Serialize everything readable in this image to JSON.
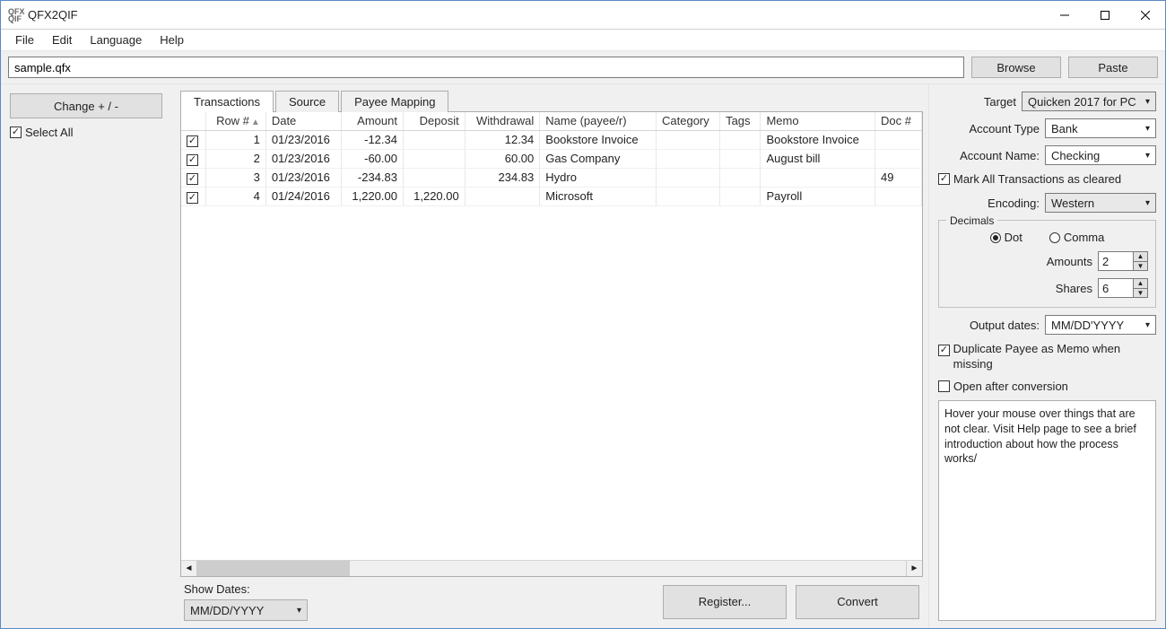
{
  "window": {
    "title": "QFX2QIF"
  },
  "menu": {
    "file": "File",
    "edit": "Edit",
    "language": "Language",
    "help": "Help"
  },
  "toolbar": {
    "file_value": "sample.qfx",
    "browse": "Browse",
    "paste": "Paste"
  },
  "left": {
    "change_btn": "Change + / -",
    "select_all": "Select All"
  },
  "tabs": {
    "transactions": "Transactions",
    "source": "Source",
    "payee_mapping": "Payee Mapping"
  },
  "grid": {
    "headers": {
      "row": "Row #",
      "date": "Date",
      "amount": "Amount",
      "deposit": "Deposit",
      "withdrawal": "Withdrawal",
      "name": "Name (payee/r)",
      "category": "Category",
      "tags": "Tags",
      "memo": "Memo",
      "doc": "Doc #"
    },
    "rows": [
      {
        "n": "1",
        "date": "01/23/2016",
        "amount": "-12.34",
        "deposit": "",
        "withdrawal": "12.34",
        "name": "Bookstore Invoice",
        "category": "",
        "tags": "",
        "memo": "Bookstore Invoice",
        "doc": ""
      },
      {
        "n": "2",
        "date": "01/23/2016",
        "amount": "-60.00",
        "deposit": "",
        "withdrawal": "60.00",
        "name": "Gas Company",
        "category": "",
        "tags": "",
        "memo": "August bill",
        "doc": ""
      },
      {
        "n": "3",
        "date": "01/23/2016",
        "amount": "-234.83",
        "deposit": "",
        "withdrawal": "234.83",
        "name": "Hydro",
        "category": "",
        "tags": "",
        "memo": "",
        "doc": "49"
      },
      {
        "n": "4",
        "date": "01/24/2016",
        "amount": "1,220.00",
        "deposit": "1,220.00",
        "withdrawal": "",
        "name": "Microsoft",
        "category": "",
        "tags": "",
        "memo": "Payroll",
        "doc": ""
      }
    ]
  },
  "bottom": {
    "show_dates_label": "Show Dates:",
    "date_format": "MM/DD/YYYY",
    "register": "Register...",
    "convert": "Convert"
  },
  "right": {
    "target_label": "Target",
    "target_value": "Quicken 2017 for PC",
    "acct_type_label": "Account Type",
    "acct_type_value": "Bank",
    "acct_name_label": "Account Name:",
    "acct_name_value": "Checking",
    "mark_cleared": "Mark All Transactions as cleared",
    "encoding_label": "Encoding:",
    "encoding_value": "Western",
    "decimals_legend": "Decimals",
    "dot_label": "Dot",
    "comma_label": "Comma",
    "amounts_label": "Amounts",
    "amounts_value": "2",
    "shares_label": "Shares",
    "shares_value": "6",
    "output_dates_label": "Output dates:",
    "output_dates_value": "MM/DD'YYYY",
    "dup_payee": "Duplicate Payee as Memo when missing",
    "open_after": "Open after conversion",
    "hint": "Hover your mouse over things that are not clear. Visit Help page to see a brief introduction about how the process works/"
  }
}
